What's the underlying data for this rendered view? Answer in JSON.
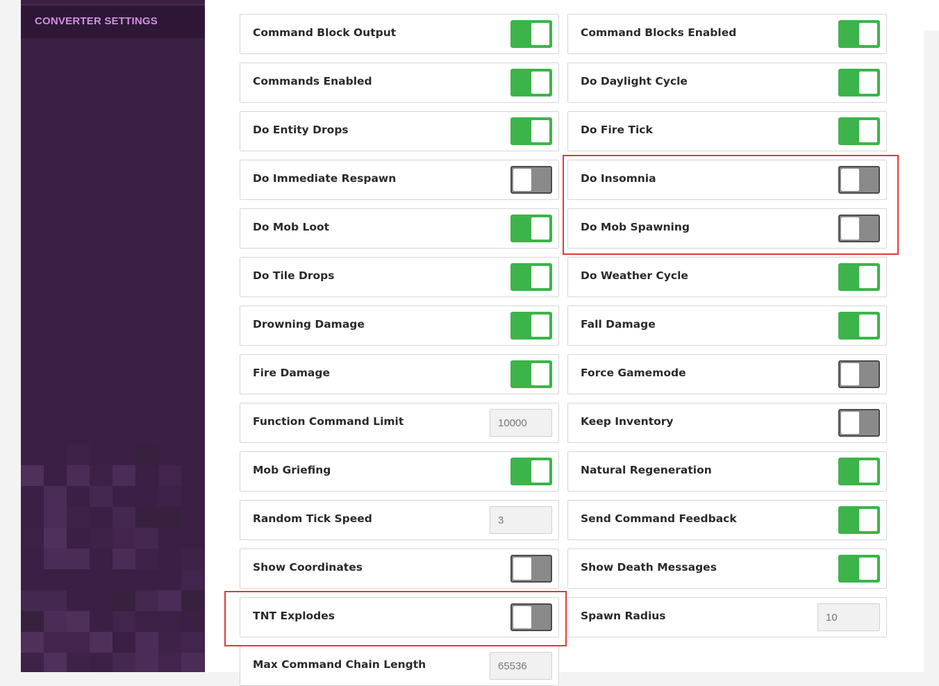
{
  "sidebar": {
    "title": "CONVERTER SETTINGS"
  },
  "settings": [
    {
      "label": "Command Block Output",
      "type": "toggle",
      "value": true
    },
    {
      "label": "Command Blocks Enabled",
      "type": "toggle",
      "value": true
    },
    {
      "label": "Commands Enabled",
      "type": "toggle",
      "value": true
    },
    {
      "label": "Do Daylight Cycle",
      "type": "toggle",
      "value": true
    },
    {
      "label": "Do Entity Drops",
      "type": "toggle",
      "value": true
    },
    {
      "label": "Do Fire Tick",
      "type": "toggle",
      "value": true
    },
    {
      "label": "Do Immediate Respawn",
      "type": "toggle",
      "value": false
    },
    {
      "label": "Do Insomnia",
      "type": "toggle",
      "value": false
    },
    {
      "label": "Do Mob Loot",
      "type": "toggle",
      "value": true
    },
    {
      "label": "Do Mob Spawning",
      "type": "toggle",
      "value": false
    },
    {
      "label": "Do Tile Drops",
      "type": "toggle",
      "value": true
    },
    {
      "label": "Do Weather Cycle",
      "type": "toggle",
      "value": true
    },
    {
      "label": "Drowning Damage",
      "type": "toggle",
      "value": true
    },
    {
      "label": "Fall Damage",
      "type": "toggle",
      "value": true
    },
    {
      "label": "Fire Damage",
      "type": "toggle",
      "value": true
    },
    {
      "label": "Force Gamemode",
      "type": "toggle",
      "value": false
    },
    {
      "label": "Function Command Limit",
      "type": "number",
      "value": "10000"
    },
    {
      "label": "Keep Inventory",
      "type": "toggle",
      "value": false
    },
    {
      "label": "Mob Griefing",
      "type": "toggle",
      "value": true
    },
    {
      "label": "Natural Regeneration",
      "type": "toggle",
      "value": true
    },
    {
      "label": "Random Tick Speed",
      "type": "number",
      "value": "3"
    },
    {
      "label": "Send Command Feedback",
      "type": "toggle",
      "value": true
    },
    {
      "label": "Show Coordinates",
      "type": "toggle",
      "value": false
    },
    {
      "label": "Show Death Messages",
      "type": "toggle",
      "value": true
    },
    {
      "label": "TNT Explodes",
      "type": "toggle",
      "value": false
    },
    {
      "label": "Spawn Radius",
      "type": "number",
      "value": "10"
    },
    {
      "label": "Max Command Chain Length",
      "type": "number",
      "value": "65536"
    }
  ],
  "colors": {
    "toggle_on": "#3cb44a",
    "toggle_off": "#8a8a8a",
    "sidebar_bg": "#3b1f44",
    "sidebar_title": "#d28fe0",
    "highlight": "#e03a3a"
  }
}
